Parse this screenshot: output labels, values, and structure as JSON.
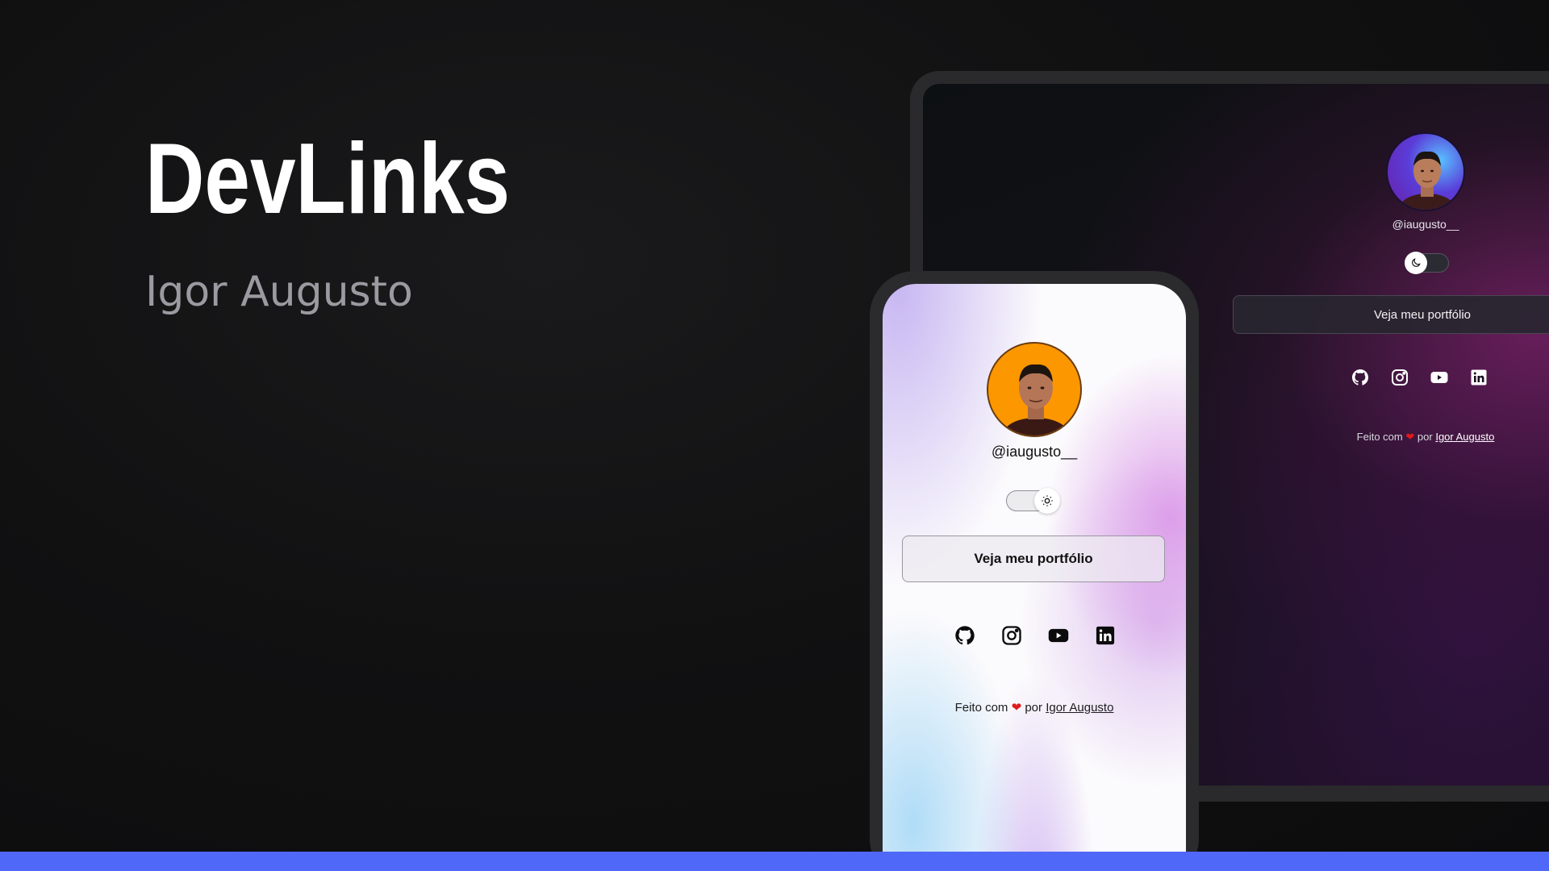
{
  "hero": {
    "title": "DevLinks",
    "subtitle": "Igor Augusto"
  },
  "desktop": {
    "handle": "@iaugusto__",
    "button_label": "Veja meu portfólio",
    "footer": {
      "prefix": "Feito com",
      "heart": "❤",
      "middle": "por",
      "author": "Igor Augusto"
    },
    "theme": "dark",
    "socials": [
      "github-icon",
      "instagram-icon",
      "youtube-icon",
      "linkedin-icon"
    ]
  },
  "phone": {
    "handle": "@iaugusto__",
    "button_label": "Veja meu portfólio",
    "footer": {
      "prefix": "Feito com",
      "heart": "❤",
      "middle": "por",
      "author": "Igor Augusto"
    },
    "theme": "light",
    "socials": [
      "github-icon",
      "instagram-icon",
      "youtube-icon",
      "linkedin-icon"
    ]
  },
  "colors": {
    "accent_bar": "#4f68f8",
    "heart": "#e01919",
    "avatar_light_bg": "#fd9700"
  }
}
